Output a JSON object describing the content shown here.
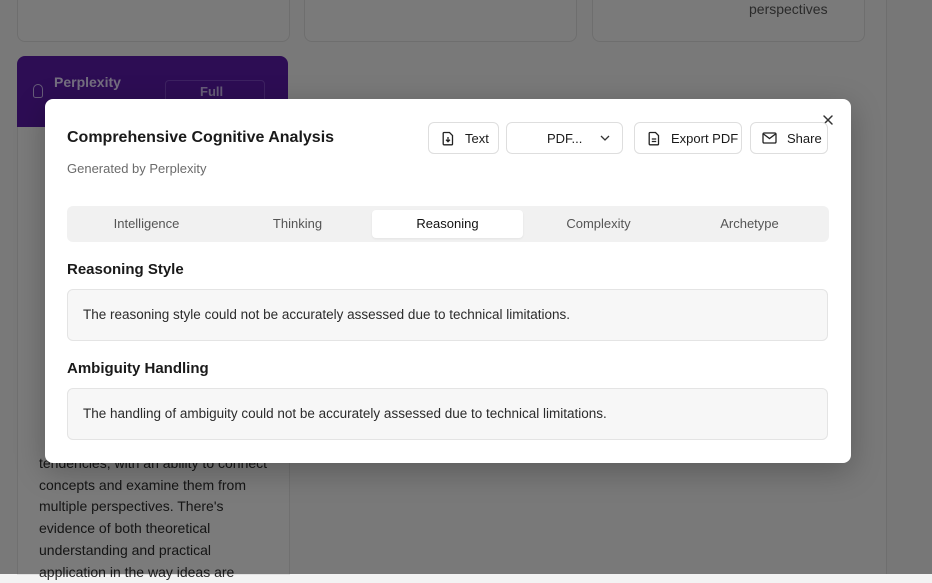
{
  "background": {
    "card_text_perspectives": "perspectives",
    "insight_card": {
      "title": "Perplexity",
      "button_label": "Full Report"
    },
    "left_paragraph": "tendencies, with an ability to connect concepts and examine them from multiple perspectives. There's evidence of both theoretical understanding and practical application in the way ideas are"
  },
  "modal": {
    "title": "Comprehensive Cognitive Analysis",
    "subtitle": "Generated by Perplexity",
    "toolbar": {
      "text_label": "Text",
      "format_select_value": "PDF...",
      "export_label": "Export PDF",
      "share_label": "Share"
    },
    "tabs": [
      {
        "label": "Intelligence",
        "active": false
      },
      {
        "label": "Thinking",
        "active": false
      },
      {
        "label": "Reasoning",
        "active": true
      },
      {
        "label": "Complexity",
        "active": false
      },
      {
        "label": "Archetype",
        "active": false
      }
    ],
    "sections": [
      {
        "heading": "Reasoning Style",
        "body": "The reasoning style could not be accurately assessed due to technical limitations."
      },
      {
        "heading": "Ambiguity Handling",
        "body": "The handling of ambiguity could not be accurately assessed due to technical limitations."
      }
    ]
  },
  "colors": {
    "accent_purple": "#5b1ba8",
    "overlay": "rgba(0,0,0,0.5)"
  }
}
